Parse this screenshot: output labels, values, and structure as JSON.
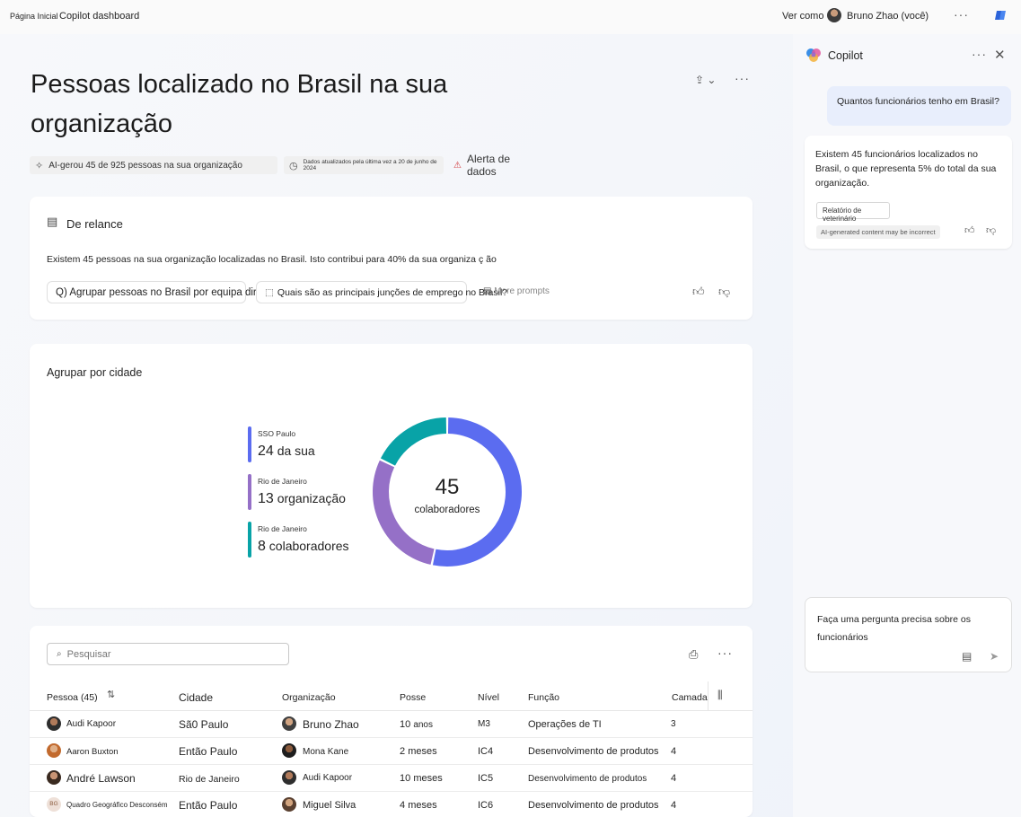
{
  "topbar": {
    "crumb_home": "Página Inicial",
    "crumb_current": "Copilot dashboard",
    "view_as_label": "Ver como",
    "user_name": "Bruno Zhao (você)",
    "more": "···"
  },
  "main": {
    "title": "Pessoas localizado no Brasil na sua organização",
    "share_icon": "share-icon",
    "more": "···",
    "chips": {
      "ai_note": "AI-gerou 45 de 925 pessoas na sua organização",
      "updated": "Dados atualizados pela última vez a 20 de junho de 2024",
      "alert": "Alerta de dados"
    }
  },
  "glance": {
    "title": "De relance",
    "summary": "Existem 45 pessoas na sua organização localizadas no Brasil. Isto contribui para 40% da sua organiza ç ão",
    "prompt1": "Q) Agrupar pessoas no Brasil por equipa direta",
    "prompt2": "Quais são as principais junções de emprego no Brasil?",
    "more_prompts": "More prompts"
  },
  "group": {
    "title": "Agrupar por cidade",
    "center_value": "45",
    "center_label": "colaboradores",
    "legend": [
      {
        "name": "SSO Paulo",
        "value": "24",
        "suffix": "da sua",
        "color": "#5b6cf0"
      },
      {
        "name": "Rio de Janeiro",
        "value": "13",
        "suffix": "organização",
        "color": "#9570c7"
      },
      {
        "name": "Rio de Janeiro",
        "value": "8",
        "suffix": "colaboradores",
        "color": "#08a3a7"
      }
    ]
  },
  "chart_data": {
    "type": "pie",
    "categories": [
      "SSO Paulo",
      "Rio de Janeiro",
      "Rio de Janeiro"
    ],
    "values": [
      24,
      13,
      8
    ],
    "colors": [
      "#5b6cf0",
      "#9570c7",
      "#08a3a7"
    ],
    "title": "Agrupar por cidade"
  },
  "table": {
    "search_placeholder": "Pesquisar",
    "more": "···",
    "columns": [
      "Pessoa (45)",
      "Cidade",
      "Organização",
      "Posse",
      "Nível",
      "Função",
      "Camada"
    ],
    "rows": [
      {
        "person": "Audi Kapoor",
        "city": "Sã0 Paulo",
        "manager": "Bruno Zhao",
        "tenure_n": "10",
        "tenure_u": "anos",
        "level": "M3",
        "role": "Operações de TI",
        "layer": "3"
      },
      {
        "person": "Aaron Buxton",
        "city": "Então Paulo",
        "manager": "Mona Kane",
        "tenure_n": "2",
        "tenure_u": "meses",
        "level": "IC4",
        "role": "Desenvolvimento de produtos",
        "layer": "4"
      },
      {
        "person": "André Lawson",
        "city": "Rio de Janeiro",
        "manager": "Audi Kapoor",
        "tenure_n": "10",
        "tenure_u": "meses",
        "level": "IC5",
        "role": "Desenvolvimento de produtos",
        "layer": "4"
      },
      {
        "person": "Quadro Geográfico Desconsém",
        "city": "Então Paulo",
        "manager": "Miguel Silva",
        "tenure_n": "4",
        "tenure_u": "meses",
        "level": "IC6",
        "role": "Desenvolvimento de produtos",
        "layer": "4",
        "initials": "BG"
      }
    ]
  },
  "copilot": {
    "title": "Copilot",
    "more": "···",
    "user_message": "Quantos funcionários tenho em Brasil?",
    "bot_message": "Existem 45 funcionários localizados no Brasil, o que representa 5% do total da sua organização.",
    "reference": "Relatório de veterinário",
    "ai_note": "AI-generated content may be incorrect",
    "composer_text": "Faça uma pergunta precisa sobre os funcionários"
  }
}
